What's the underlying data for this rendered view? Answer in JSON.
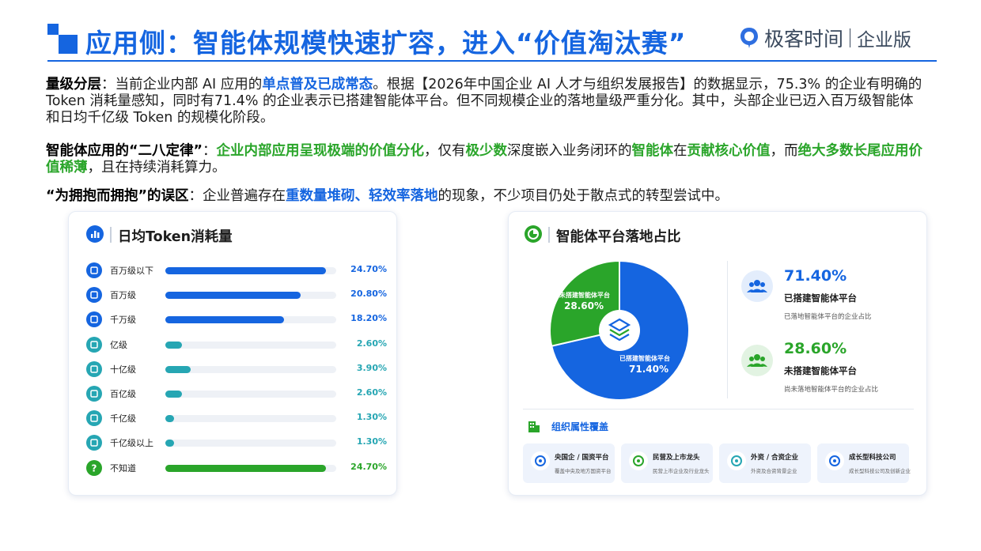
{
  "header": {
    "title": "应用侧：智能体规模快速扩容，进入“价值淘汰赛”",
    "brand_name": "极客时间",
    "brand_sub": "企业版"
  },
  "colors": {
    "primary_blue": "#1565e0",
    "accent_green": "#2aa52a",
    "teal": "#26a6b3"
  },
  "paragraphs": {
    "p1": {
      "label": "量级分层",
      "sep": "：",
      "t1": "当前企业内部 AI 应用的",
      "h1": "单点普及已成常态",
      "t2": "。根据【2026年中国企业 AI 人才与组织发展报告】的数据显示，75.3% 的企业有明确的 Token 消耗量感知，同时有71.4% 的企业表示已搭建智能体平台。但不同规模企业的落地量级严重分化。其中，头部企业已迈入百万级智能体和日均千亿级 Token 的规模化阶段。"
    },
    "p2": {
      "label": "智能体应用的“二八定律”",
      "sep": "：",
      "h1": "企业内部应用呈现极端的价值分化",
      "t1": "，仅有",
      "h2": "极少数",
      "t2": "深度嵌入业务闭环的",
      "h3": "智能体",
      "t3": "在",
      "h4": "贡献核心价值",
      "t4": "，而",
      "h5": "绝大多数长尾应用价值稀薄",
      "t5": "，且在持续消耗算力。"
    },
    "p3": {
      "label": "“为拥抱而拥抱”的误区",
      "sep": "：",
      "t1": "企业普遍存在",
      "h1": "重数量堆砌、轻效率落地",
      "t2": "的现象，不少项目仍处于散点式的转型尝试中。"
    }
  },
  "chart_data": [
    {
      "type": "bar",
      "title": "日均Token消耗量",
      "categories": [
        "百万级以下",
        "百万级",
        "千万级",
        "亿级",
        "十亿级",
        "百亿级",
        "千亿级",
        "千亿级以上",
        "不知道"
      ],
      "values": [
        24.7,
        20.8,
        18.2,
        2.6,
        3.9,
        2.6,
        1.3,
        1.3,
        24.7
      ],
      "value_labels": [
        "24.70%",
        "20.80%",
        "18.20%",
        "2.60%",
        "3.90%",
        "2.60%",
        "1.30%",
        "1.30%",
        "24.70%"
      ],
      "bar_colors": [
        "#1565e0",
        "#1565e0",
        "#1565e0",
        "#26a6b3",
        "#26a6b3",
        "#26a6b3",
        "#26a6b3",
        "#26a6b3",
        "#2aa52a"
      ],
      "icon_names": [
        "building-icon",
        "building-icon",
        "pie-icon",
        "database-icon",
        "chart-up-icon",
        "server-icon",
        "bar-chart-icon",
        "globe-icon",
        "question-icon"
      ],
      "max": 24.7
    },
    {
      "type": "pie",
      "title": "智能体平台落地占比",
      "series": [
        {
          "name": "已搭建智能体平台",
          "value": 71.4,
          "label": "71.40%",
          "color": "#1565e0"
        },
        {
          "name": "未搭建智能体平台",
          "value": 28.6,
          "label": "28.60%",
          "color": "#2aa52a"
        }
      ]
    }
  ],
  "stats": [
    {
      "value": "71.40%",
      "label": "已搭建智能体平台",
      "desc": "已落地智能体平台的企业占比",
      "color": "#1565e0"
    },
    {
      "value": "28.60%",
      "label": "未搭建智能体平台",
      "desc": "尚未落地智能体平台的企业占比",
      "color": "#2aa52a"
    }
  ],
  "org": {
    "title": "组织属性覆盖",
    "items": [
      {
        "title": "央国企 / 国资平台",
        "sub": "覆盖中央及地方国资平台",
        "icon": "bank-icon",
        "color": "#1565e0"
      },
      {
        "title": "民营及上市龙头",
        "sub": "民营上市企业及行业龙头",
        "icon": "award-icon",
        "color": "#2aa52a"
      },
      {
        "title": "外资 / 合资企业",
        "sub": "外资及合资背景企业",
        "icon": "globe-icon",
        "color": "#26a6b3"
      },
      {
        "title": "成长型科技公司",
        "sub": "成长型科技公司及创新企业",
        "icon": "rocket-icon",
        "color": "#1565e0"
      }
    ]
  }
}
